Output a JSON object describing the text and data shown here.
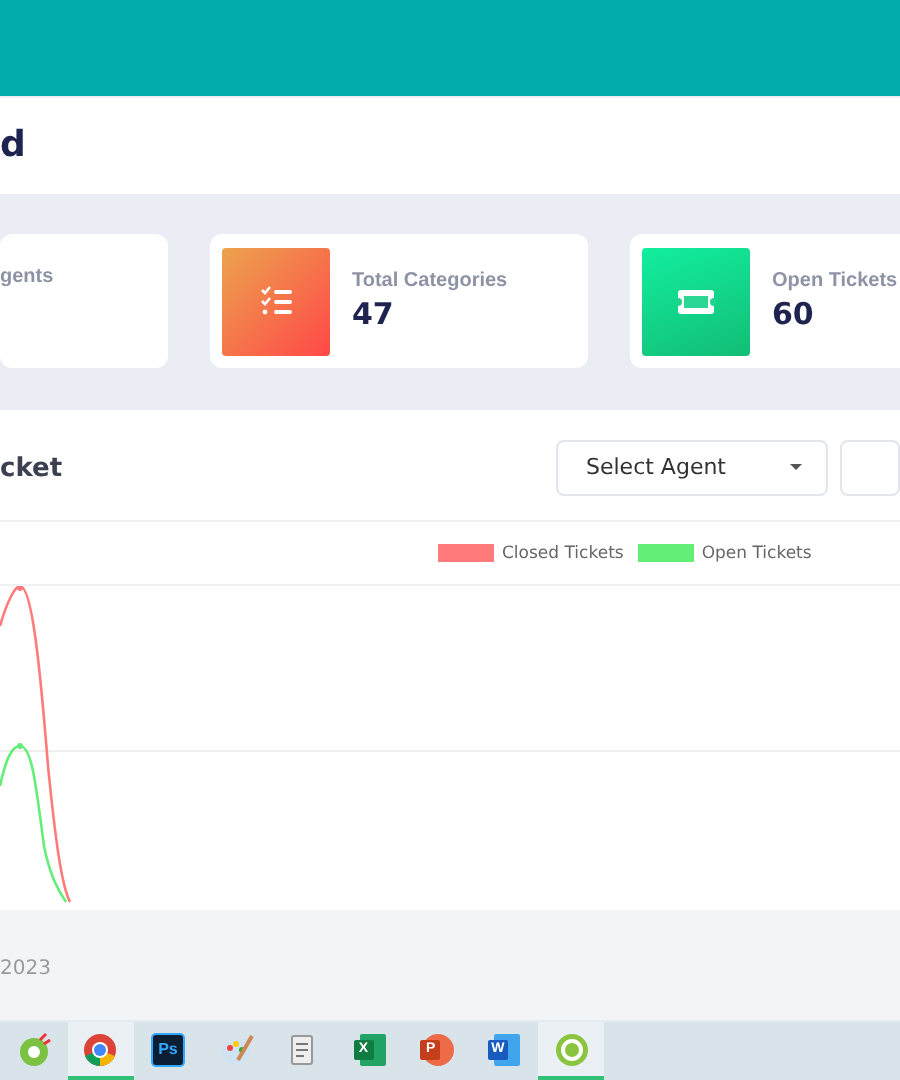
{
  "header": {
    "title": "d"
  },
  "stats": [
    {
      "kind": "partial",
      "label": "gents"
    },
    {
      "kind": "categories",
      "label": "Total Categories",
      "value": "47"
    },
    {
      "kind": "tickets",
      "label": "Open Tickets",
      "value": "60"
    }
  ],
  "panel": {
    "title": "cket",
    "filters": [
      {
        "label": "Select Agent"
      },
      {
        "kind": "blank"
      }
    ],
    "legend": [
      {
        "label": "Closed Tickets",
        "color": "#ff7b7b"
      },
      {
        "label": "Open Tickets",
        "color": "#63ee78"
      }
    ]
  },
  "footer": {
    "text": "2023"
  },
  "taskbar": [
    {
      "kind": "leaf",
      "active": false
    },
    {
      "kind": "browser",
      "active": true
    },
    {
      "kind": "square",
      "label": "Ps",
      "active": false
    },
    {
      "kind": "palette",
      "active": false
    },
    {
      "kind": "doc",
      "active": false
    },
    {
      "kind": "green",
      "label": "X",
      "active": false
    },
    {
      "kind": "orange",
      "label": "P",
      "active": false
    },
    {
      "kind": "blue",
      "label": "W",
      "active": false
    },
    {
      "kind": "ring",
      "active": true
    }
  ]
}
